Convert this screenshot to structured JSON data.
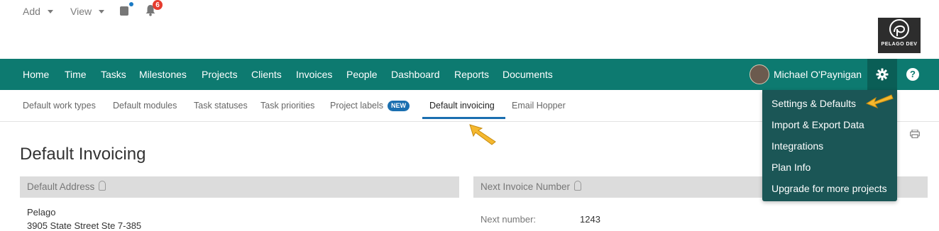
{
  "topbar": {
    "add_label": "Add",
    "view_label": "View",
    "notification_count": "6",
    "logo_text": "PELAGO DEV"
  },
  "nav": {
    "items": [
      "Home",
      "Time",
      "Tasks",
      "Milestones",
      "Projects",
      "Clients",
      "Invoices",
      "People",
      "Dashboard",
      "Reports",
      "Documents"
    ],
    "user_name": "Michael O'Paynigan",
    "help_symbol": "?"
  },
  "subnav": {
    "items": [
      "Default work types",
      "Default modules",
      "Task statuses",
      "Task priorities",
      "Project labels",
      "Default invoicing",
      "Email Hopper"
    ],
    "new_badge": "NEW",
    "active": "Default invoicing"
  },
  "settings_menu": {
    "items": [
      "Settings & Defaults",
      "Import & Export Data",
      "Integrations",
      "Plan Info",
      "Upgrade for more projects"
    ]
  },
  "page": {
    "title": "Default Invoicing",
    "default_address": {
      "header": "Default Address",
      "lines": [
        "Pelago",
        "3905 State Street Ste 7-385"
      ]
    },
    "next_invoice": {
      "header": "Next Invoice Number",
      "label": "Next number:",
      "value": "1243"
    }
  },
  "colors": {
    "nav_bg": "#0d7a70",
    "dropdown_bg": "#1b5656",
    "accent_blue": "#1a6fb0",
    "badge_red": "#e63c2f",
    "arrow_yellow": "#f5b82e"
  }
}
